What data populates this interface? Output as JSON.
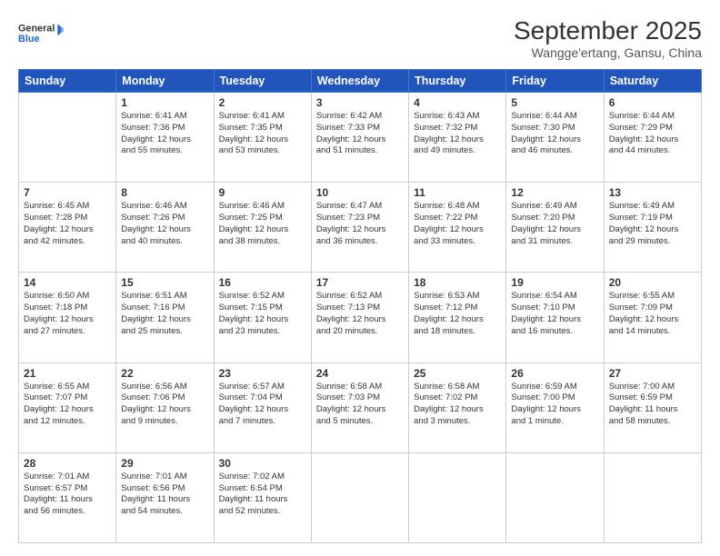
{
  "header": {
    "logo_general": "General",
    "logo_blue": "Blue",
    "month": "September 2025",
    "location": "Wangge'ertang, Gansu, China"
  },
  "days_of_week": [
    "Sunday",
    "Monday",
    "Tuesday",
    "Wednesday",
    "Thursday",
    "Friday",
    "Saturday"
  ],
  "weeks": [
    [
      {
        "day": "",
        "lines": []
      },
      {
        "day": "1",
        "lines": [
          "Sunrise: 6:41 AM",
          "Sunset: 7:36 PM",
          "Daylight: 12 hours",
          "and 55 minutes."
        ]
      },
      {
        "day": "2",
        "lines": [
          "Sunrise: 6:41 AM",
          "Sunset: 7:35 PM",
          "Daylight: 12 hours",
          "and 53 minutes."
        ]
      },
      {
        "day": "3",
        "lines": [
          "Sunrise: 6:42 AM",
          "Sunset: 7:33 PM",
          "Daylight: 12 hours",
          "and 51 minutes."
        ]
      },
      {
        "day": "4",
        "lines": [
          "Sunrise: 6:43 AM",
          "Sunset: 7:32 PM",
          "Daylight: 12 hours",
          "and 49 minutes."
        ]
      },
      {
        "day": "5",
        "lines": [
          "Sunrise: 6:44 AM",
          "Sunset: 7:30 PM",
          "Daylight: 12 hours",
          "and 46 minutes."
        ]
      },
      {
        "day": "6",
        "lines": [
          "Sunrise: 6:44 AM",
          "Sunset: 7:29 PM",
          "Daylight: 12 hours",
          "and 44 minutes."
        ]
      }
    ],
    [
      {
        "day": "7",
        "lines": [
          "Sunrise: 6:45 AM",
          "Sunset: 7:28 PM",
          "Daylight: 12 hours",
          "and 42 minutes."
        ]
      },
      {
        "day": "8",
        "lines": [
          "Sunrise: 6:46 AM",
          "Sunset: 7:26 PM",
          "Daylight: 12 hours",
          "and 40 minutes."
        ]
      },
      {
        "day": "9",
        "lines": [
          "Sunrise: 6:46 AM",
          "Sunset: 7:25 PM",
          "Daylight: 12 hours",
          "and 38 minutes."
        ]
      },
      {
        "day": "10",
        "lines": [
          "Sunrise: 6:47 AM",
          "Sunset: 7:23 PM",
          "Daylight: 12 hours",
          "and 36 minutes."
        ]
      },
      {
        "day": "11",
        "lines": [
          "Sunrise: 6:48 AM",
          "Sunset: 7:22 PM",
          "Daylight: 12 hours",
          "and 33 minutes."
        ]
      },
      {
        "day": "12",
        "lines": [
          "Sunrise: 6:49 AM",
          "Sunset: 7:20 PM",
          "Daylight: 12 hours",
          "and 31 minutes."
        ]
      },
      {
        "day": "13",
        "lines": [
          "Sunrise: 6:49 AM",
          "Sunset: 7:19 PM",
          "Daylight: 12 hours",
          "and 29 minutes."
        ]
      }
    ],
    [
      {
        "day": "14",
        "lines": [
          "Sunrise: 6:50 AM",
          "Sunset: 7:18 PM",
          "Daylight: 12 hours",
          "and 27 minutes."
        ]
      },
      {
        "day": "15",
        "lines": [
          "Sunrise: 6:51 AM",
          "Sunset: 7:16 PM",
          "Daylight: 12 hours",
          "and 25 minutes."
        ]
      },
      {
        "day": "16",
        "lines": [
          "Sunrise: 6:52 AM",
          "Sunset: 7:15 PM",
          "Daylight: 12 hours",
          "and 23 minutes."
        ]
      },
      {
        "day": "17",
        "lines": [
          "Sunrise: 6:52 AM",
          "Sunset: 7:13 PM",
          "Daylight: 12 hours",
          "and 20 minutes."
        ]
      },
      {
        "day": "18",
        "lines": [
          "Sunrise: 6:53 AM",
          "Sunset: 7:12 PM",
          "Daylight: 12 hours",
          "and 18 minutes."
        ]
      },
      {
        "day": "19",
        "lines": [
          "Sunrise: 6:54 AM",
          "Sunset: 7:10 PM",
          "Daylight: 12 hours",
          "and 16 minutes."
        ]
      },
      {
        "day": "20",
        "lines": [
          "Sunrise: 6:55 AM",
          "Sunset: 7:09 PM",
          "Daylight: 12 hours",
          "and 14 minutes."
        ]
      }
    ],
    [
      {
        "day": "21",
        "lines": [
          "Sunrise: 6:55 AM",
          "Sunset: 7:07 PM",
          "Daylight: 12 hours",
          "and 12 minutes."
        ]
      },
      {
        "day": "22",
        "lines": [
          "Sunrise: 6:56 AM",
          "Sunset: 7:06 PM",
          "Daylight: 12 hours",
          "and 9 minutes."
        ]
      },
      {
        "day": "23",
        "lines": [
          "Sunrise: 6:57 AM",
          "Sunset: 7:04 PM",
          "Daylight: 12 hours",
          "and 7 minutes."
        ]
      },
      {
        "day": "24",
        "lines": [
          "Sunrise: 6:58 AM",
          "Sunset: 7:03 PM",
          "Daylight: 12 hours",
          "and 5 minutes."
        ]
      },
      {
        "day": "25",
        "lines": [
          "Sunrise: 6:58 AM",
          "Sunset: 7:02 PM",
          "Daylight: 12 hours",
          "and 3 minutes."
        ]
      },
      {
        "day": "26",
        "lines": [
          "Sunrise: 6:59 AM",
          "Sunset: 7:00 PM",
          "Daylight: 12 hours",
          "and 1 minute."
        ]
      },
      {
        "day": "27",
        "lines": [
          "Sunrise: 7:00 AM",
          "Sunset: 6:59 PM",
          "Daylight: 11 hours",
          "and 58 minutes."
        ]
      }
    ],
    [
      {
        "day": "28",
        "lines": [
          "Sunrise: 7:01 AM",
          "Sunset: 6:57 PM",
          "Daylight: 11 hours",
          "and 56 minutes."
        ]
      },
      {
        "day": "29",
        "lines": [
          "Sunrise: 7:01 AM",
          "Sunset: 6:56 PM",
          "Daylight: 11 hours",
          "and 54 minutes."
        ]
      },
      {
        "day": "30",
        "lines": [
          "Sunrise: 7:02 AM",
          "Sunset: 6:54 PM",
          "Daylight: 11 hours",
          "and 52 minutes."
        ]
      },
      {
        "day": "",
        "lines": []
      },
      {
        "day": "",
        "lines": []
      },
      {
        "day": "",
        "lines": []
      },
      {
        "day": "",
        "lines": []
      }
    ]
  ]
}
